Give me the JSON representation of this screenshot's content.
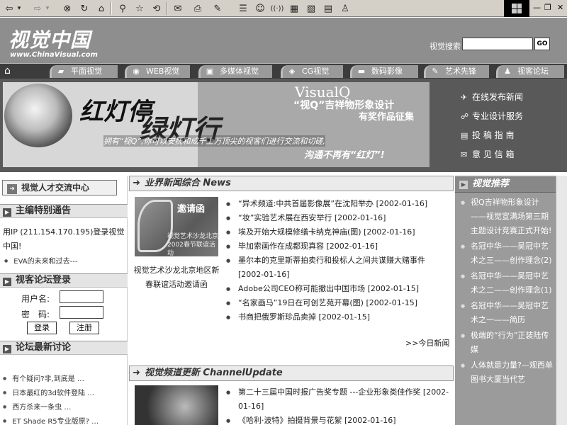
{
  "toolbar": {
    "back": "⇦",
    "back_drop": "▾",
    "forward": "⇨",
    "forward_drop": "▾",
    "stop": "⊗",
    "refresh": "↻",
    "home": "⌂",
    "search": "⚲",
    "favorites": "☆",
    "history": "⟲",
    "mail": "✉",
    "print": "⎙",
    "edit": "✎",
    "discuss": "☰",
    "messenger": "☺",
    "window_minimize": "—",
    "window_restore": "❐",
    "window_close": "✕"
  },
  "header": {
    "logo_cn": "视觉中国",
    "logo_en": "www.ChinaVisual.com",
    "search_label": "视觉搜索",
    "search_value": "",
    "search_go": "GO"
  },
  "nav": {
    "home_icon": "⌂",
    "items": [
      {
        "label": "平面视觉",
        "icon": "▰"
      },
      {
        "label": "WEB视觉",
        "icon": "◉"
      },
      {
        "label": "多媒体视觉",
        "icon": "▣"
      },
      {
        "label": "CG视觉",
        "icon": "◈"
      },
      {
        "label": "数码影像",
        "icon": "▬"
      },
      {
        "label": "艺术先锋",
        "icon": "✎"
      },
      {
        "label": "视客论坛",
        "icon": "♟"
      }
    ]
  },
  "banner": {
    "title1": "红灯停",
    "title2": "绿灯行",
    "visualq": "VisualQ",
    "subtitle1": "“视Q”吉祥物形象设计",
    "subtitle2": "有奖作品征集",
    "tagline1": "拥有“视Q”,你可以安抚和成千上万顶尖的视客们进行交流和切磋,",
    "tagline2": "沟通不再有“红灯”!"
  },
  "right_links": [
    {
      "icon": "✈",
      "label": "在线发布新闻"
    },
    {
      "icon": "☍",
      "label": "专业设计服务"
    },
    {
      "icon": "▤",
      "label": "投 稿 指 南"
    },
    {
      "icon": "✉",
      "label": "意 见 信 箱"
    }
  ],
  "left": {
    "talent_arrow": "➜",
    "talent_label": "视觉人才交流中心",
    "sec_notice": "主编特别通告",
    "notice_text": "用IP (211.154.170.195)登录视觉中国!",
    "notice_item": "EVA的未来和过去---",
    "sec_login": "视客论坛登录",
    "user_label": "用户名:",
    "pass_label": "密　码:",
    "login_btn": "登录",
    "register_btn": "注册",
    "sec_forum": "论坛最新讨论",
    "forum_items": [
      "有个疑问?非,到底是 …",
      "日本最红的3d软件登陆 …",
      "西方杀来一条虫 …",
      "ET Shade R5专业版原? …"
    ]
  },
  "middle": {
    "arrow": "➜",
    "news_title": "业界新闻综合 News",
    "thumb1_title": "邀请函",
    "thumb1_sub": "视觉艺术沙龙北京\n2002春节联谊活动",
    "thumb1_caption": "视觉艺术沙龙北京地区新春联谊活动邀请函",
    "news": [
      "“异术频道:中共首届影像展”在沈阳举办 [2002-01-16]",
      "“妆”实验艺术展在西安举行 [2002-01-16]",
      "埃及开始大规模修缮卡纳克神庙(图) [2002-01-16]",
      "毕加索画作在成都现真容 [2002-01-16]",
      "墨尔本的克里斯蒂拍卖行和投标人之间共谋赚大赌事件 [2002-01-16]",
      "Adobe公司CEO称可能撤出中国市场 [2002-01-15]",
      "“名家画马”19日在可创艺苑开幕(图) [2002-01-15]",
      "书商把俄罗斯珍品卖掉 [2002-01-15]"
    ],
    "more": ">>今日新闻",
    "channel_title": "视觉频道更新 ChannelUpdate",
    "channel": [
      "第二十三届中国时报广告奖专题 ---企业形象类佳作奖 [2002-01-16]",
      "《哈利·波特》拍摄背景与花絮 [2002-01-16]"
    ]
  },
  "right": {
    "title": "视觉推荐",
    "badge": "▶",
    "items": [
      "视Q吉祥物形象设计——视觉宣满场第三期主题设计竞赛正式开始!",
      "名冠中华——吴冠中艺术之三——创作理念(2)",
      "名冠中华——吴冠中艺术之二——创作理念(1)",
      "名冠中华——吴冠中艺术之一——简历",
      "极端的“行为”正装陆传媒",
      "人体就是力量?—观西单图书大厦当代艺"
    ]
  }
}
